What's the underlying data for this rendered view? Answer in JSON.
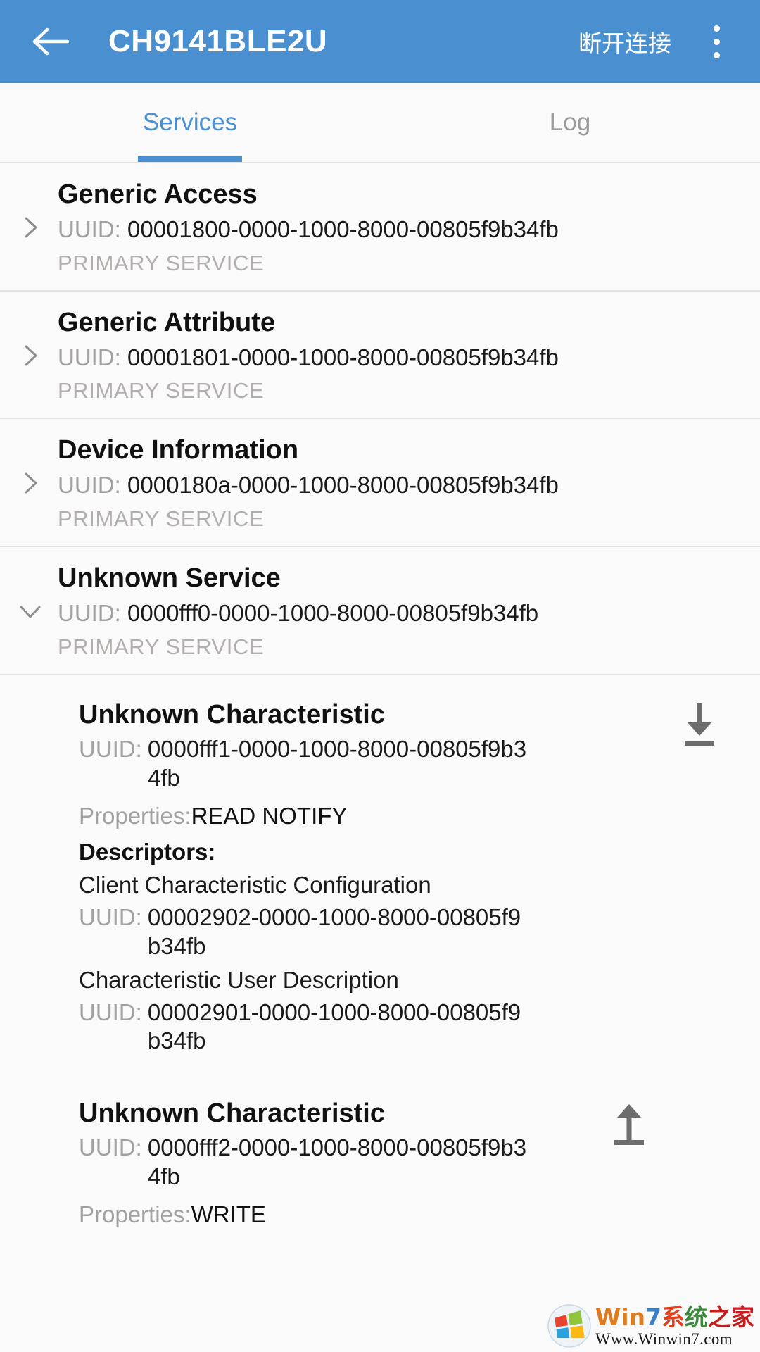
{
  "appbar": {
    "back_icon": "arrow-left-icon",
    "title": "CH9141BLE2U",
    "action_label": "断开连接",
    "overflow_icon": "overflow-menu-icon"
  },
  "tabs": [
    {
      "label": "Services",
      "active": true
    },
    {
      "label": "Log",
      "active": false
    }
  ],
  "labels": {
    "uuid": "UUID:",
    "properties": "Properties:",
    "descriptors": "Descriptors:",
    "primary_service": "PRIMARY SERVICE"
  },
  "colors": {
    "accent": "#4a90d1",
    "appbar_bg": "#4a90d1",
    "page_bg": "#fafafa",
    "divider": "#e2e2e2",
    "muted_text": "#a3a0a0",
    "primary_text": "#111111"
  },
  "services": [
    {
      "name": "Generic Access",
      "uuid": "00001800-0000-1000-8000-00805f9b34fb",
      "type": "PRIMARY SERVICE",
      "expanded": false,
      "chevron": "chevron-right-icon"
    },
    {
      "name": "Generic Attribute",
      "uuid": "00001801-0000-1000-8000-00805f9b34fb",
      "type": "PRIMARY SERVICE",
      "expanded": false,
      "chevron": "chevron-right-icon"
    },
    {
      "name": "Device Information",
      "uuid": "0000180a-0000-1000-8000-00805f9b34fb",
      "type": "PRIMARY SERVICE",
      "expanded": false,
      "chevron": "chevron-right-icon"
    },
    {
      "name": "Unknown Service",
      "uuid": "0000fff0-0000-1000-8000-00805f9b34fb",
      "type": "PRIMARY SERVICE",
      "expanded": true,
      "chevron": "chevron-down-icon"
    }
  ],
  "characteristics": [
    {
      "name": "Unknown Characteristic",
      "uuid": "0000fff1-0000-1000-8000-00805f9b34fb",
      "properties": "READ NOTIFY",
      "action_icon": "download-icon",
      "descriptors": [
        {
          "name": "Client Characteristic Configuration",
          "uuid": "00002902-0000-1000-8000-00805f9b34fb"
        },
        {
          "name": "Characteristic User Description",
          "uuid": "00002901-0000-1000-8000-00805f9b34fb"
        }
      ]
    },
    {
      "name": "Unknown Characteristic",
      "uuid": "0000fff2-0000-1000-8000-00805f9b34fb",
      "properties": "WRITE",
      "action_icon": "upload-icon",
      "descriptors": []
    }
  ],
  "watermark": {
    "part1": "Win",
    "part2": "7",
    "part3": "系",
    "part4": "统",
    "part5": "之家",
    "url": "Www.Winwin7.com"
  }
}
